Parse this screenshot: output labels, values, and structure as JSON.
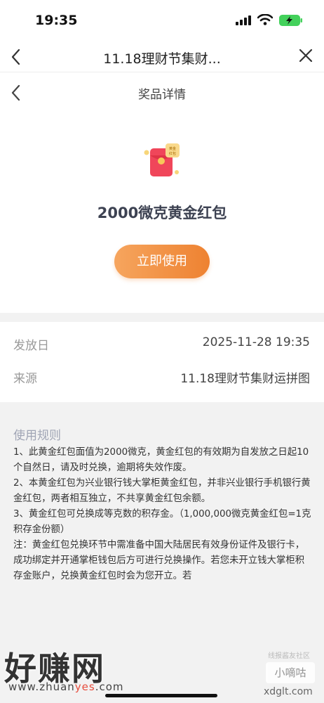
{
  "status_bar": {
    "time": "19:35"
  },
  "nav": {
    "title": "11.18理财节集财..."
  },
  "subheader": {
    "title": "奖品详情"
  },
  "prize": {
    "envelope_text": "黄金\n红包",
    "name": "2000微克黄金红包",
    "use_button": "立即使用"
  },
  "info": {
    "rows": [
      {
        "label": "发放日",
        "value": "2025-11-28 19:35"
      },
      {
        "label": "来源",
        "value": "11.18理财节集财运拼图"
      }
    ]
  },
  "rules": {
    "title": "使用规则",
    "lines": [
      "1、此黄金红包面值为2000微克，黄金红包的有效期为自发放之日起10个自然日，请及时兑换，逾期将失效作废。",
      "2、本黄金红包为兴业银行钱大掌柜黄金红包，并非兴业银行手机银行黄金红包，两者相互独立，不共享黄金红包余额。",
      "3、黄金红包可兑换成等克数的积存金。（1,000,000微克黄金红包=1克积存金份额）",
      "注：黄金红包兑换环节中需准备中国大陆居民有效身份证件及银行卡，成功绑定并开通掌柜钱包后方可进行兑换操作。若您未开立钱大掌柜积存金账户，兑换黄金红包时会为您开立。若"
    ]
  },
  "watermark": {
    "left_text": "好赚网",
    "url_prefix": "www.zhuan",
    "url_yes": "yes",
    "url_suffix": ".com",
    "right_small": "线报酱友社区",
    "right_text": "小嘀咕",
    "right_url": "xdglt.com"
  },
  "colors": {
    "accent_orange": "#ee8231",
    "envelope_red": "#f0465a",
    "label_gray": "#999999"
  }
}
